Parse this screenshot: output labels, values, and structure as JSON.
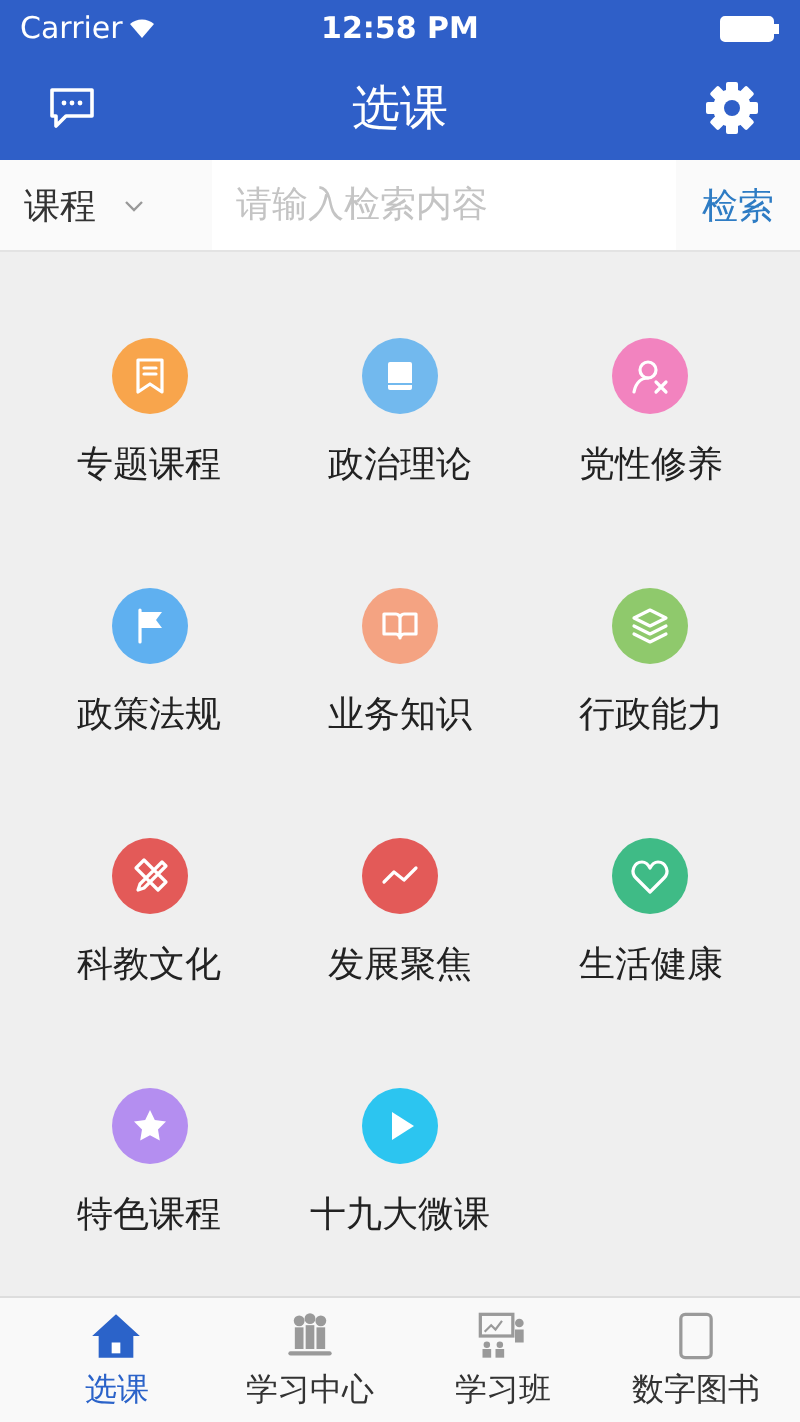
{
  "status_bar": {
    "carrier": "Carrier",
    "time": "12:58 PM"
  },
  "nav_bar": {
    "title": "选课"
  },
  "search": {
    "category": "课程",
    "placeholder": "请输入检索内容",
    "button": "检索"
  },
  "categories": [
    {
      "label": "专题课程",
      "color": "#f8a54c"
    },
    {
      "label": "政治理论",
      "color": "#72b9ee"
    },
    {
      "label": "党性修养",
      "color": "#f283bf"
    },
    {
      "label": "政策法规",
      "color": "#5fb0f0"
    },
    {
      "label": "业务知识",
      "color": "#f4a382"
    },
    {
      "label": "行政能力",
      "color": "#8fc96c"
    },
    {
      "label": "科教文化",
      "color": "#e35a58"
    },
    {
      "label": "发展聚焦",
      "color": "#e35a58"
    },
    {
      "label": "生活健康",
      "color": "#3fbb86"
    },
    {
      "label": "特色课程",
      "color": "#b48ef0"
    },
    {
      "label": "十九大微课",
      "color": "#2cc5f0"
    }
  ],
  "tab_bar": [
    {
      "label": "选课",
      "selected": true
    },
    {
      "label": "学习中心",
      "selected": false
    },
    {
      "label": "学习班",
      "selected": false
    },
    {
      "label": "数字图书",
      "selected": false
    }
  ]
}
